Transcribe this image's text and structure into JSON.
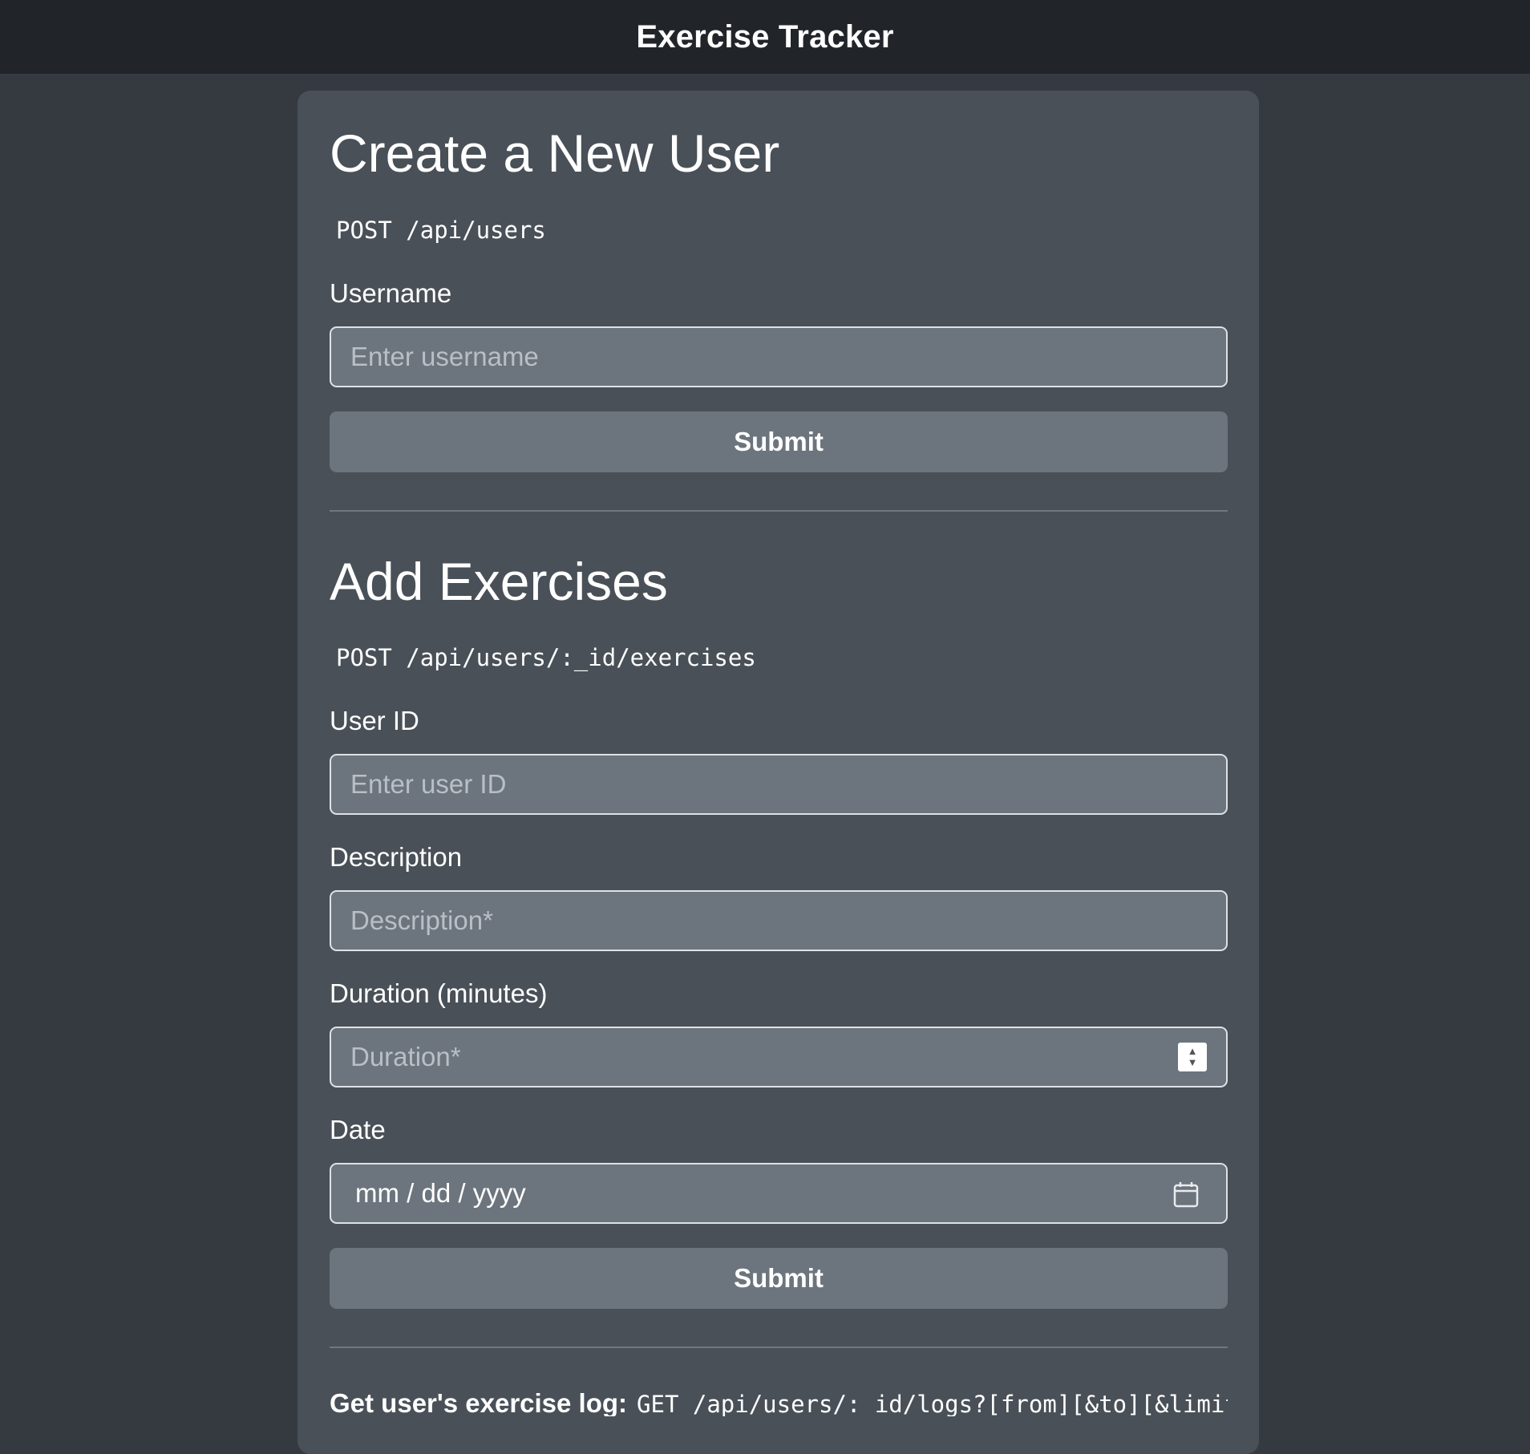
{
  "header": {
    "title": "Exercise Tracker"
  },
  "create_user": {
    "title": "Create a New User",
    "endpoint": "POST /api/users",
    "username_label": "Username",
    "username_placeholder": "Enter username",
    "submit_label": "Submit"
  },
  "add_exercises": {
    "title": "Add Exercises",
    "endpoint": "POST /api/users/:_id/exercises",
    "user_id_label": "User ID",
    "user_id_placeholder": "Enter user ID",
    "description_label": "Description",
    "description_placeholder": "Description*",
    "duration_label": "Duration (minutes)",
    "duration_placeholder": "Duration*",
    "date_label": "Date",
    "date_placeholder": "mm / dd / yyyy",
    "submit_label": "Submit"
  },
  "log": {
    "label": "Get user's exercise log:",
    "endpoint": "GET /api/users/:_id/logs?[from][&to][&limit]"
  },
  "icons": {
    "duration_stepper": "stepper-arrows-icon",
    "date_picker": "calendar-icon"
  },
  "colors": {
    "page_background": "#343a40",
    "header_background": "#212529",
    "card_background": "#495057",
    "field_background": "#6c757d",
    "button_background": "#6c757d"
  }
}
